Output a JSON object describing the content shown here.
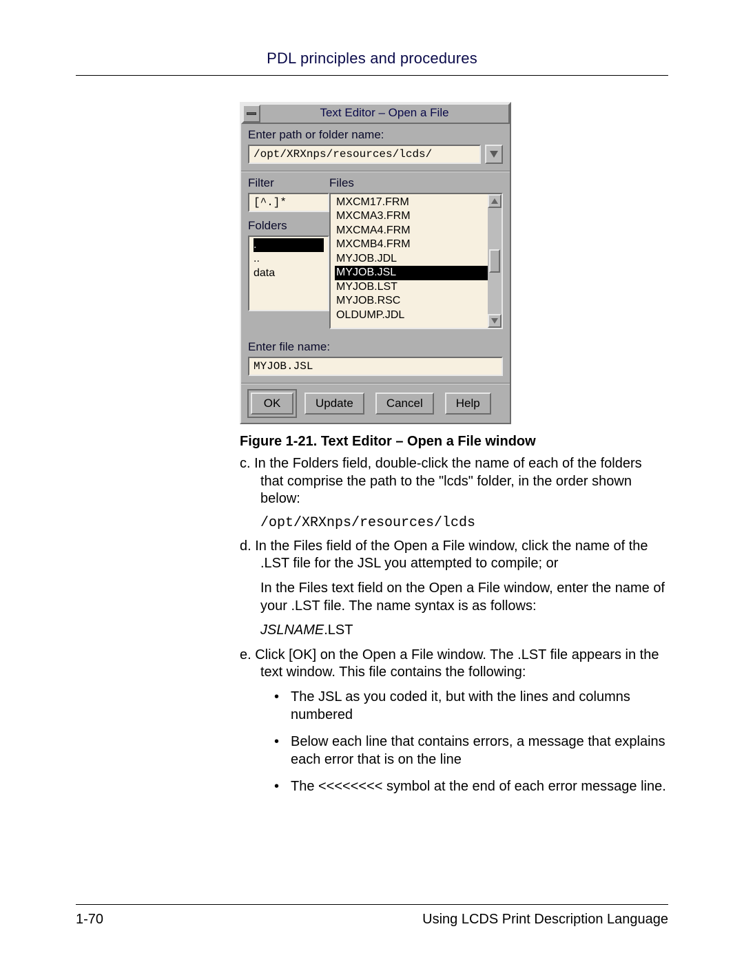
{
  "header": {
    "title": "PDL principles and procedures"
  },
  "dialog": {
    "title": "Text Editor – Open a File",
    "path_label": "Enter path or folder name:",
    "path_value": "/opt/XRXnps/resources/lcds/",
    "filter_label": "Filter",
    "filter_value": "[^.]*",
    "folders_label": "Folders",
    "folders": [
      ".",
      "..",
      "data"
    ],
    "folders_selected": 0,
    "files_label": "Files",
    "files": [
      "MXCM17.FRM",
      "MXCMA3.FRM",
      "MXCMA4.FRM",
      "MXCMB4.FRM",
      "MYJOB.JDL",
      "MYJOB.JSL",
      "MYJOB.LST",
      "MYJOB.RSC",
      "OLDUMP.JDL"
    ],
    "files_selected": "MYJOB.JSL",
    "filename_label": "Enter file name:",
    "filename_value": "MYJOB.JSL",
    "buttons": {
      "ok": "OK",
      "update": "Update",
      "cancel": "Cancel",
      "help": "Help"
    }
  },
  "caption": "Figure 1-21. Text Editor – Open a File window",
  "body": {
    "c": "c.  In the Folders field, double-click the name of each of the folders that comprise the path to the \"lcds\" folder, in the order shown below:",
    "c_code": "/opt/XRXnps/resources/lcds",
    "d1": "d.  In the Files field of the Open a File window, click the name of the .LST file for the JSL you attempted to compile; or",
    "d2": "In the Files text field on the Open a File window, enter the name of your .LST file. The name syntax is as follows:",
    "d_code_ital": "JSLNAME",
    "d_code_rest": ".LST",
    "e": "e.  Click [OK] on the Open a File window. The  .LST file appears in the text window. This file contains the following:",
    "bullets": [
      "The JSL as you coded it, but with the lines and columns numbered",
      "Below each line that contains errors, a message that explains each error that is on the line",
      "The <<<<<<<< symbol at the end of each error message line."
    ]
  },
  "footer": {
    "page": "1-70",
    "book": "Using LCDS Print Description Language"
  }
}
